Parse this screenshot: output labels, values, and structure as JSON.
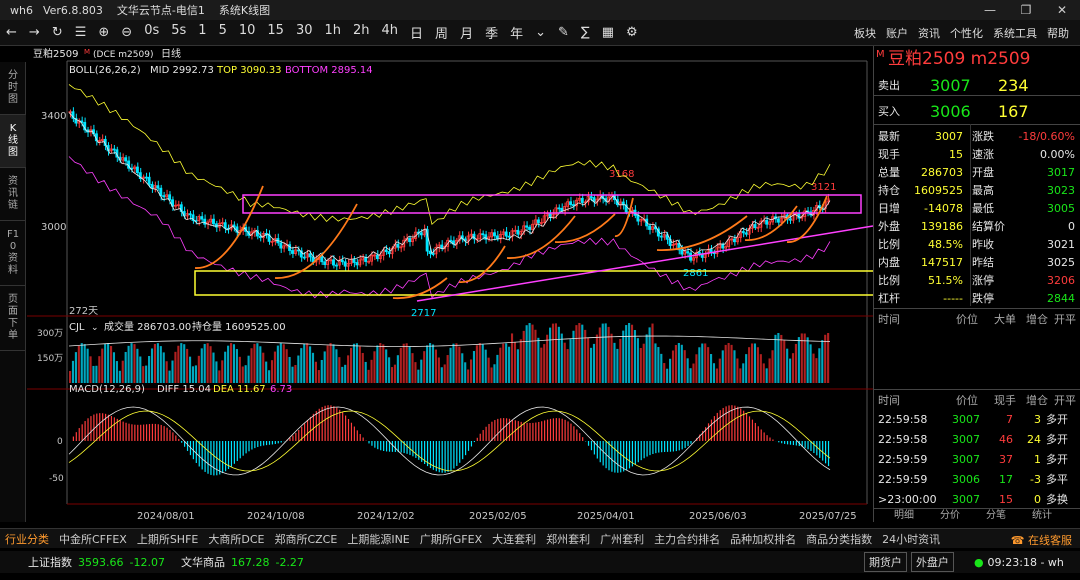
{
  "app": {
    "name": "wh6",
    "version": "Ver6.8.803",
    "server": "文华云节点-电信1",
    "window": "系统K线图"
  },
  "toolbar": {
    "periods": [
      "0s",
      "5s",
      "1",
      "5",
      "10",
      "15",
      "30",
      "1h",
      "2h",
      "4h",
      "日",
      "周",
      "月",
      "季",
      "年"
    ],
    "right_menu": [
      "板块",
      "账户",
      "资讯",
      "个性化",
      "系统工具",
      "帮助"
    ]
  },
  "left_nav": [
    {
      "label": "分时图"
    },
    {
      "label": "K线图"
    },
    {
      "label": "资讯链"
    },
    {
      "label": "F10资料"
    },
    {
      "label": "页面下单"
    }
  ],
  "chart_header": {
    "symbol": "豆粕2509",
    "sup": "M",
    "code": "(DCE m2509)",
    "period": "日线"
  },
  "boll": {
    "label": "BOLL(26,26,2)",
    "mid": "MID 2992.73",
    "top": "TOP 3090.33",
    "bottom": "BOTTOM 2895.14"
  },
  "vol": {
    "label": "CJL",
    "volume": "成交量 286703.00",
    "oi": "持仓量 1609525.00"
  },
  "macd": {
    "label": "MACD(12,26,9)",
    "diff": "DIFF 15.04",
    "dea": "DEA 11.67",
    "macd": "6.73"
  },
  "chart_labels": {
    "y3400": "3400",
    "y3000": "3000",
    "v300": "300万",
    "v150": "150万",
    "m0": "0",
    "m50": "-50",
    "days": "272天",
    "high1": "3168",
    "high2": "3121",
    "low1": "2717",
    "low2": "2861"
  },
  "x_dates": [
    "2024/08/01",
    "2024/10/08",
    "2024/12/02",
    "2025/02/05",
    "2025/04/01",
    "2025/06/03",
    "2025/07/25"
  ],
  "quote": {
    "title": "豆粕2509  m2509",
    "sell_label": "卖出",
    "sell_price": "3007",
    "sell_vol": "234",
    "buy_label": "买入",
    "buy_price": "3006",
    "buy_vol": "167",
    "rows": [
      {
        "l1": "最新",
        "v1": "3007",
        "l2": "涨跌",
        "v2": "-18/0.60%"
      },
      {
        "l1": "现手",
        "v1": "15",
        "l2": "速涨",
        "v2": "0.00%"
      },
      {
        "l1": "总量",
        "v1": "286703",
        "l2": "开盘",
        "v2": "3017"
      },
      {
        "l1": "持仓",
        "v1": "1609525",
        "l2": "最高",
        "v2": "3023"
      },
      {
        "l1": "日增",
        "v1": "-14078",
        "l2": "最低",
        "v2": "3005"
      },
      {
        "l1": "外盘",
        "v1": "139186",
        "l2": "结算价",
        "v2": "0"
      },
      {
        "l1": "比例",
        "v1": "48.5%",
        "l2": "昨收",
        "v2": "3021"
      },
      {
        "l1": "内盘",
        "v1": "147517",
        "l2": "昨结",
        "v2": "3025"
      },
      {
        "l1": "比例",
        "v1": "51.5%",
        "l2": "涨停",
        "v2": "3206"
      },
      {
        "l1": "杠杆",
        "v1": "-----",
        "l2": "跌停",
        "v2": "2844"
      }
    ],
    "tick_header": [
      "时间",
      "价位",
      "大单",
      "增仓",
      "开平"
    ],
    "tick_header2": [
      "时间",
      "价位",
      "现手",
      "增仓",
      "开平"
    ],
    "ticks": [
      {
        "t": "22:59:58",
        "p": "3007",
        "n": "7",
        "d": "3",
        "k": "多开"
      },
      {
        "t": "22:59:58",
        "p": "3007",
        "n": "46",
        "d": "24",
        "k": "多开"
      },
      {
        "t": "22:59:59",
        "p": "3007",
        "n": "37",
        "d": "1",
        "k": "多开"
      },
      {
        "t": "22:59:59",
        "p": "3006",
        "n": "17",
        "d": "-3",
        "k": "多平"
      },
      {
        "t": ">23:00:00",
        "p": "3007",
        "n": "15",
        "d": "0",
        "k": "多换"
      }
    ],
    "tabs": [
      "明细",
      "分价",
      "分笔",
      "统计"
    ]
  },
  "bottom_tabs": [
    "行业分类",
    "中金所CFFEX",
    "上期所SHFE",
    "大商所DCE",
    "郑商所CZCE",
    "上期能源INE",
    "广期所GFEX",
    "大连套利",
    "郑州套利",
    "广州套利",
    "主力合约排名",
    "品种加权排名",
    "商品分类指数",
    "24小时资讯"
  ],
  "status": {
    "idx1_name": "上证指数",
    "idx1_val": "3593.66",
    "idx1_chg": "-12.07",
    "idx2_name": "文华商品",
    "idx2_val": "167.28",
    "idx2_chg": "-2.27",
    "btn1": "期货户",
    "btn2": "外盘户",
    "time": "09:23:18 - wh",
    "service": "在线客服"
  },
  "colors": {
    "up": "#ff3c3c",
    "down": "#00e5ff",
    "boll_mid": "#e6e6e6",
    "boll_top": "#ffff33",
    "boll_bottom": "#ff40ff",
    "band": "#ff40ff",
    "band2": "#ffff33"
  }
}
